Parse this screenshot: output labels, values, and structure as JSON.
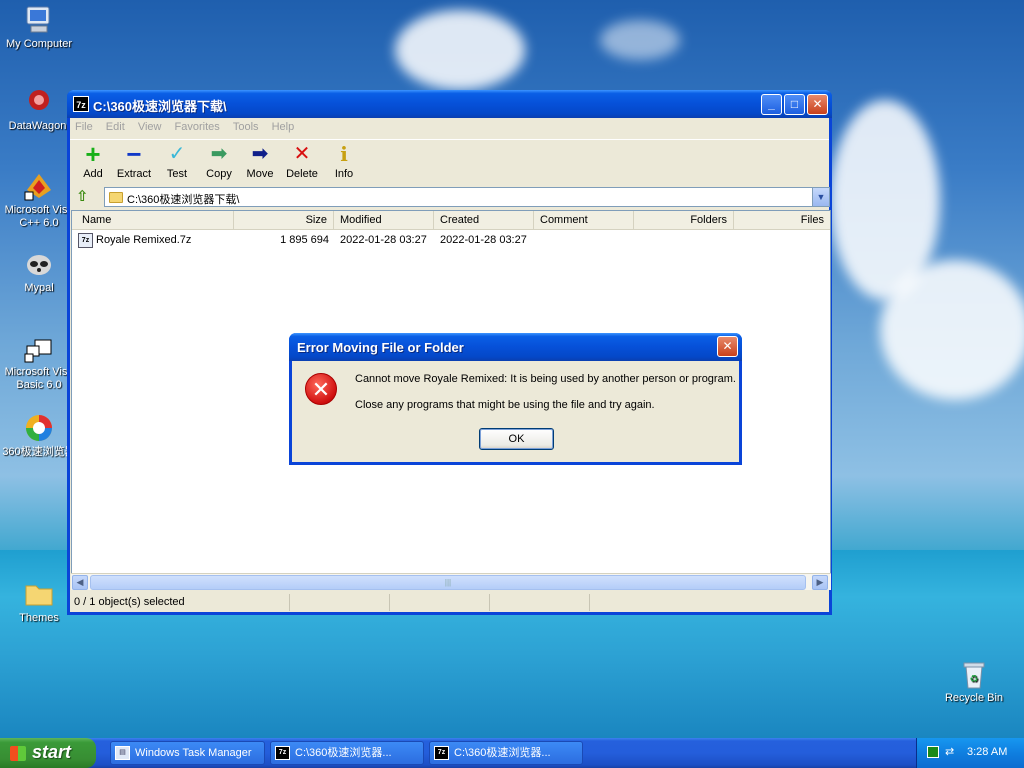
{
  "desktop": {
    "icons": [
      {
        "label": "My Computer",
        "icon": "computer-icon"
      },
      {
        "label": "DataWagon.",
        "icon": "datawagon-icon"
      },
      {
        "label": "Microsoft Visu C++ 6.0",
        "icon": "vc6-icon"
      },
      {
        "label": "Mypal",
        "icon": "mypal-icon"
      },
      {
        "label": "Microsoft Visu Basic 6.0",
        "icon": "vb6-icon"
      },
      {
        "label": "360极速浏览器",
        "icon": "360-browser-icon"
      },
      {
        "label": "Themes",
        "icon": "folder-icon"
      },
      {
        "label": "Recycle Bin",
        "icon": "recycle-bin-icon"
      }
    ]
  },
  "window": {
    "title": "C:\\360极速浏览器下载\\",
    "app_icon": "7z",
    "menu": [
      "File",
      "Edit",
      "View",
      "Favorites",
      "Tools",
      "Help"
    ],
    "toolbar": [
      {
        "label": "Add",
        "icon": "plus-icon",
        "glyph": "+",
        "color": "#18b018"
      },
      {
        "label": "Extract",
        "icon": "minus-icon",
        "glyph": "−",
        "color": "#1038c8"
      },
      {
        "label": "Test",
        "icon": "check-icon",
        "glyph": "✓",
        "color": "#3ab8d8"
      },
      {
        "label": "Copy",
        "icon": "copy-arrow-icon",
        "glyph": "➡",
        "color": "#3a9a60"
      },
      {
        "label": "Move",
        "icon": "move-arrow-icon",
        "glyph": "➡",
        "color": "#10208a"
      },
      {
        "label": "Delete",
        "icon": "delete-x-icon",
        "glyph": "✕",
        "color": "#d81010"
      },
      {
        "label": "Info",
        "icon": "info-icon",
        "glyph": "i",
        "color": "#c8a010"
      }
    ],
    "address": "C:\\360极速浏览器下载\\",
    "columns": [
      "Name",
      "Size",
      "Modified",
      "Created",
      "Comment",
      "Folders",
      "Files"
    ],
    "rows": [
      {
        "name": "Royale Remixed.7z",
        "size": "1 895 694",
        "modified": "2022-01-28 03:27",
        "created": "2022-01-28 03:27",
        "comment": "",
        "folders": "",
        "files": ""
      }
    ],
    "status": "0 / 1 object(s) selected"
  },
  "dialog": {
    "title": "Error Moving File or Folder",
    "message1": "Cannot move Royale Remixed: It is being used by another person or program.",
    "message2": "Close any programs that might be using the file and try again.",
    "ok_label": "OK"
  },
  "taskbar": {
    "start_label": "start",
    "tasks": [
      {
        "label": "Windows Task Manager"
      },
      {
        "label": "C:\\360极速浏览器..."
      },
      {
        "label": "C:\\360极速浏览器..."
      }
    ],
    "clock": "3:28 AM"
  }
}
